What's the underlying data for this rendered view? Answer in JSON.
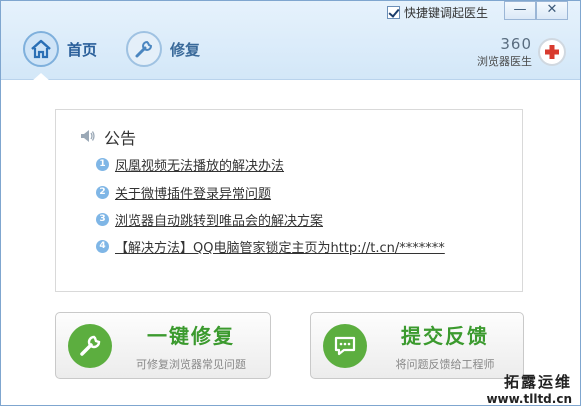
{
  "titlebar": {
    "hotkey_checked": true,
    "hotkey_label": "快捷键调起医生",
    "minimize_label": "—",
    "close_label": "✕"
  },
  "nav": {
    "home_label": "首页",
    "repair_label": "修复"
  },
  "logo": {
    "number": "360",
    "name": "浏览器医生"
  },
  "notice": {
    "title": "公告",
    "items": [
      {
        "num": "1",
        "text": "凤凰视频无法播放的解决办法"
      },
      {
        "num": "2",
        "text": "关于微博插件登录异常问题"
      },
      {
        "num": "3",
        "text": "浏览器自动跳转到唯品会的解决方案"
      },
      {
        "num": "4",
        "text": "【解决方法】QQ电脑管家锁定主页为http://t.cn/*******"
      }
    ]
  },
  "actions": {
    "repair_title": "一键修复",
    "repair_sub": "可修复浏览器常见问题",
    "feedback_title": "提交反馈",
    "feedback_sub": "将问题反馈给工程师"
  },
  "watermark": {
    "line1": "拓露运维",
    "line2": "www.tlltd.cn"
  },
  "colors": {
    "accent_blue": "#2a5f9a",
    "green": "#3b9a2e",
    "number_badge": "#7fb6e6"
  }
}
